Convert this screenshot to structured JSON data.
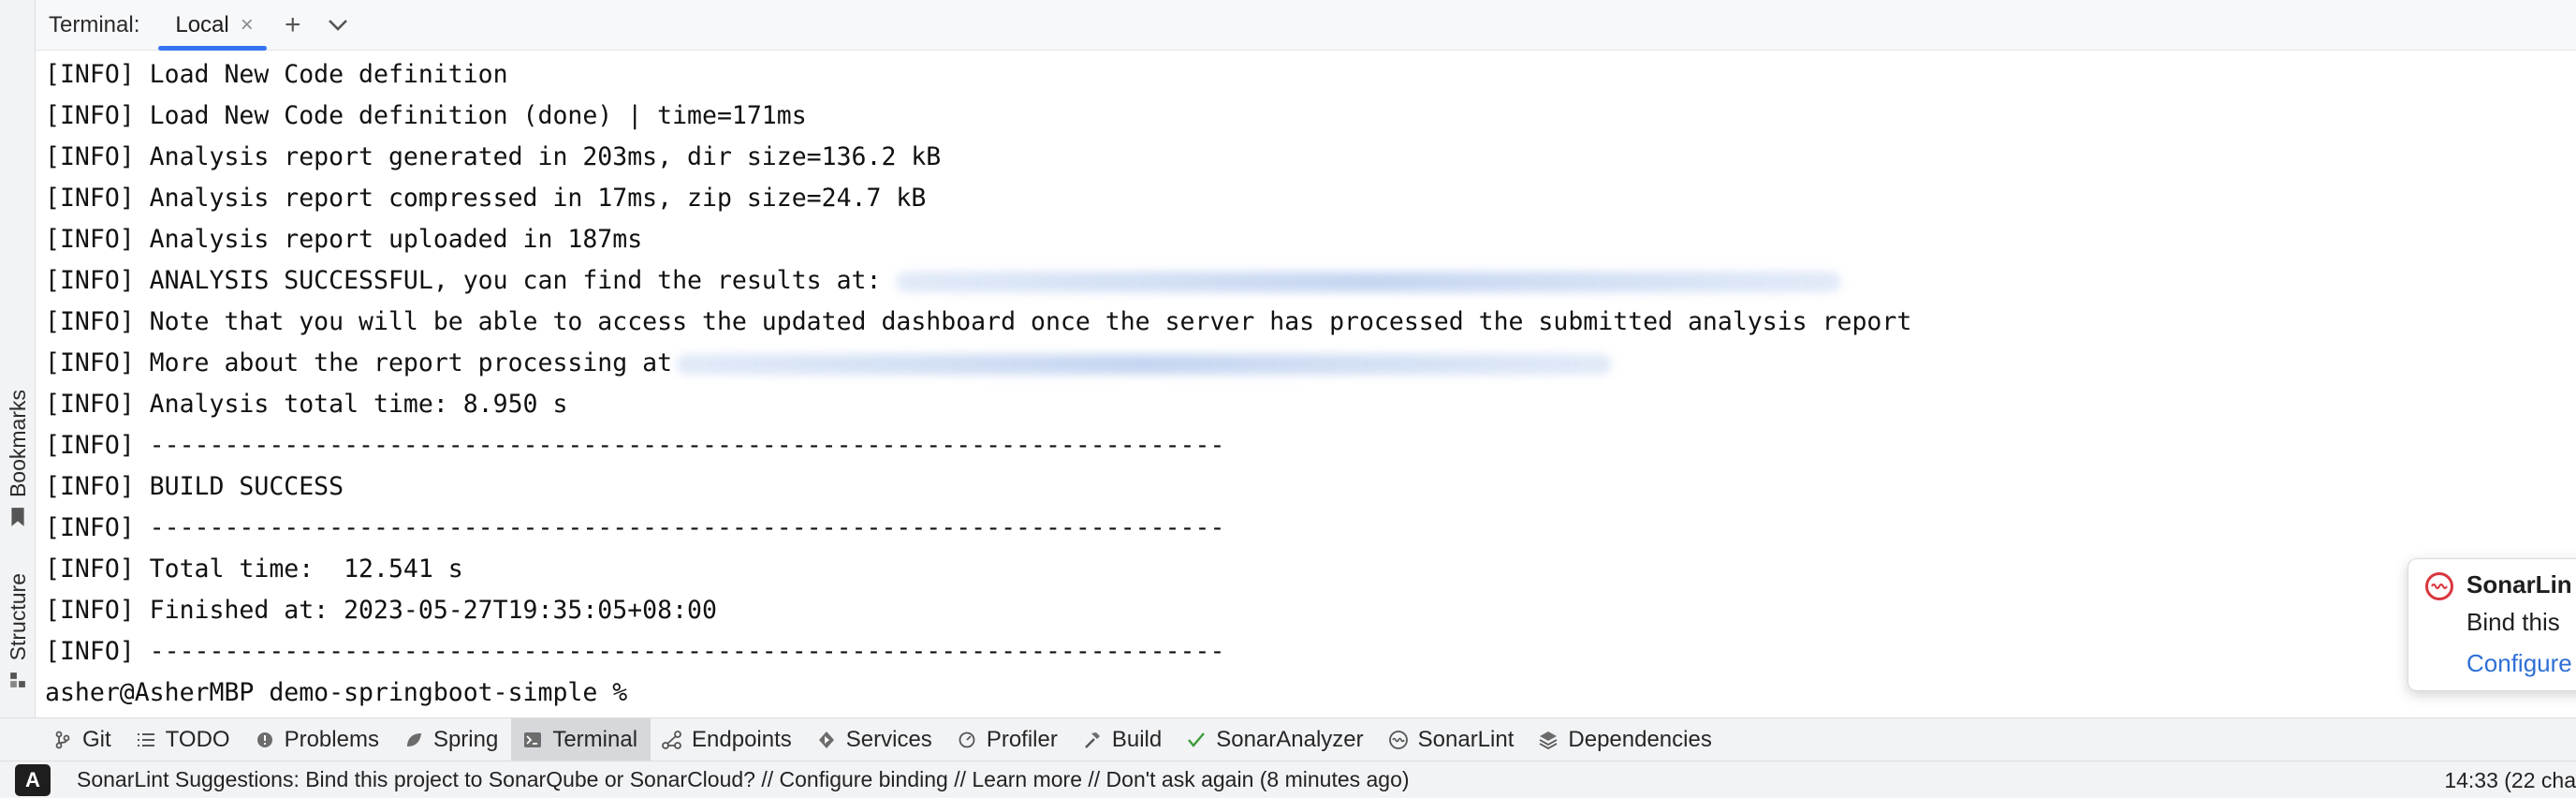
{
  "sidebar": {
    "bookmarks_label": "Bookmarks",
    "structure_label": "Structure"
  },
  "terminal": {
    "title": "Terminal:",
    "tab_label": "Local",
    "tab_close": "×",
    "new_tab": "+",
    "more": "⌄",
    "lines": [
      "[INFO] Load New Code definition",
      "[INFO] Load New Code definition (done) | time=171ms",
      "[INFO] Analysis report generated in 203ms, dir size=136.2 kB",
      "[INFO] Analysis report compressed in 17ms, zip size=24.7 kB",
      "[INFO] Analysis report uploaded in 187ms",
      "[INFO] ANALYSIS SUCCESSFUL, you can find the results at: ",
      "[INFO] Note that you will be able to access the updated dashboard once the server has processed the submitted analysis report",
      "[INFO] More about the report processing at",
      "[INFO] Analysis total time: 8.950 s",
      "[INFO] ------------------------------------------------------------------------",
      "[INFO] BUILD SUCCESS",
      "[INFO] ------------------------------------------------------------------------",
      "[INFO] Total time:  12.541 s",
      "[INFO] Finished at: 2023-05-27T19:35:05+08:00",
      "[INFO] ------------------------------------------------------------------------",
      "asher@AsherMBP demo-springboot-simple %"
    ]
  },
  "notification": {
    "title": "SonarLin",
    "text": "Bind this",
    "link": "Configure"
  },
  "tool_windows": [
    {
      "label": "Git",
      "icon": "git-branch-icon"
    },
    {
      "label": "TODO",
      "icon": "list-icon"
    },
    {
      "label": "Problems",
      "icon": "problems-icon"
    },
    {
      "label": "Spring",
      "icon": "spring-leaf-icon"
    },
    {
      "label": "Terminal",
      "icon": "terminal-icon"
    },
    {
      "label": "Endpoints",
      "icon": "endpoints-icon"
    },
    {
      "label": "Services",
      "icon": "services-icon"
    },
    {
      "label": "Profiler",
      "icon": "profiler-icon"
    },
    {
      "label": "Build",
      "icon": "hammer-icon"
    },
    {
      "label": "SonarAnalyzer",
      "icon": "checkmark-icon"
    },
    {
      "label": "SonarLint",
      "icon": "sonarlint-icon"
    },
    {
      "label": "Dependencies",
      "icon": "layers-icon"
    }
  ],
  "status": {
    "badge": "A",
    "message": "SonarLint Suggestions: Bind this project to SonarQube or SonarCloud? // Configure binding // Learn more // Don't ask again (8 minutes ago)",
    "right": "14:33 (22 cha"
  },
  "colors": {
    "accent": "#3574f0",
    "error": "#d9363e",
    "link": "#2f6fd6",
    "success_check": "#3a9b3a"
  }
}
